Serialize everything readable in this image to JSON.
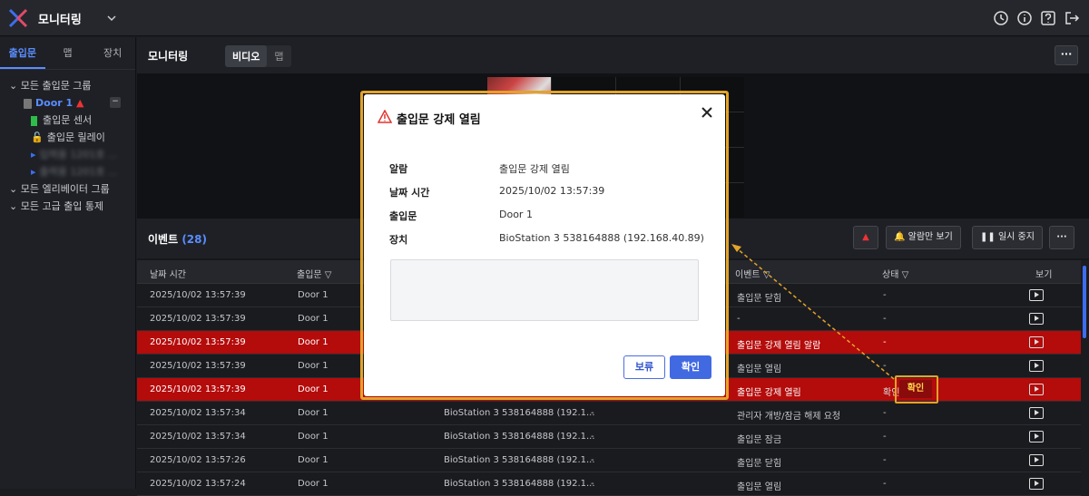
{
  "app": {
    "title": "모니터링"
  },
  "sidebar": {
    "tabs": [
      {
        "label": "출입문"
      },
      {
        "label": "맵"
      },
      {
        "label": "장치"
      }
    ],
    "tree": {
      "all_doors": "모든 출입문 그룹",
      "door1": "Door 1",
      "sensor": "출입문 센서",
      "relay": "출입문 릴레이",
      "blur1": "입력용 1201호 ...",
      "blur2": "출력용 1201호 ...",
      "elevators": "모든 엘리베이터 그룹",
      "advanced": "모든 고급 출입 통제"
    }
  },
  "monitor": {
    "title": "모니터링",
    "seg_video": "비디오",
    "seg_map": "맵",
    "more": "···"
  },
  "events": {
    "title": "이벤트",
    "count": "(28)",
    "btn_alarm_only": "알람만 보기",
    "btn_pause": "일시 중지",
    "more": "···",
    "columns": {
      "datetime": "날짜 시간",
      "door": "출입문",
      "event": "이벤트",
      "status": "상태",
      "view": "보기"
    },
    "rows": [
      {
        "datetime": "2025/10/02 13:57:39",
        "door": "Door 1",
        "device": "",
        "user": "",
        "event": "출입문 닫힘",
        "status": "-",
        "alarm": false
      },
      {
        "datetime": "2025/10/02 13:57:39",
        "door": "Door 1",
        "device": "",
        "user": "",
        "event": "-",
        "status": "-",
        "alarm": false
      },
      {
        "datetime": "2025/10/02 13:57:39",
        "door": "Door 1",
        "device": "",
        "user": "",
        "event": "출입문 강제 열림 알람",
        "status": "-",
        "alarm": true
      },
      {
        "datetime": "2025/10/02 13:57:39",
        "door": "Door 1",
        "device": "",
        "user": "",
        "event": "출입문 열림",
        "status": "-",
        "alarm": false
      },
      {
        "datetime": "2025/10/02 13:57:39",
        "door": "Door 1",
        "device": "",
        "user": "",
        "event": "출입문 강제 열림",
        "status": "",
        "alarm": true
      },
      {
        "datetime": "2025/10/02 13:57:34",
        "door": "Door 1",
        "device": "BioStation 3 538164888 (192.1...",
        "user": "-",
        "event": "관리자 개방/잠금 해제 요청",
        "status": "-",
        "alarm": false
      },
      {
        "datetime": "2025/10/02 13:57:34",
        "door": "Door 1",
        "device": "BioStation 3 538164888 (192.1...",
        "user": "-",
        "event": "출입문 잠금",
        "status": "-",
        "alarm": false
      },
      {
        "datetime": "2025/10/02 13:57:26",
        "door": "Door 1",
        "device": "BioStation 3 538164888 (192.1...",
        "user": "-",
        "event": "출입문 닫힘",
        "status": "-",
        "alarm": false
      },
      {
        "datetime": "2025/10/02 13:57:24",
        "door": "Door 1",
        "device": "BioStation 3 538164888 (192.1...",
        "user": "-",
        "event": "출입문 열림",
        "status": "-",
        "alarm": false
      }
    ],
    "ack_text": "확인",
    "confirm_label": "확인"
  },
  "dialog": {
    "title": "출입문 강제 열림",
    "fields": [
      {
        "label": "알람",
        "value": "출입문 강제 열림"
      },
      {
        "label": "날짜 시간",
        "value": "2025/10/02 13:57:39"
      },
      {
        "label": "출입문",
        "value": "Door 1"
      },
      {
        "label": "장치",
        "value": "BioStation 3 538164888 (192.168.40.89)"
      }
    ],
    "hold_label": "보류",
    "ok_label": "확인"
  },
  "colors": {
    "accent": "#5a8dff",
    "alarm_row": "#b40b0b",
    "highlight": "#e3a32a"
  }
}
